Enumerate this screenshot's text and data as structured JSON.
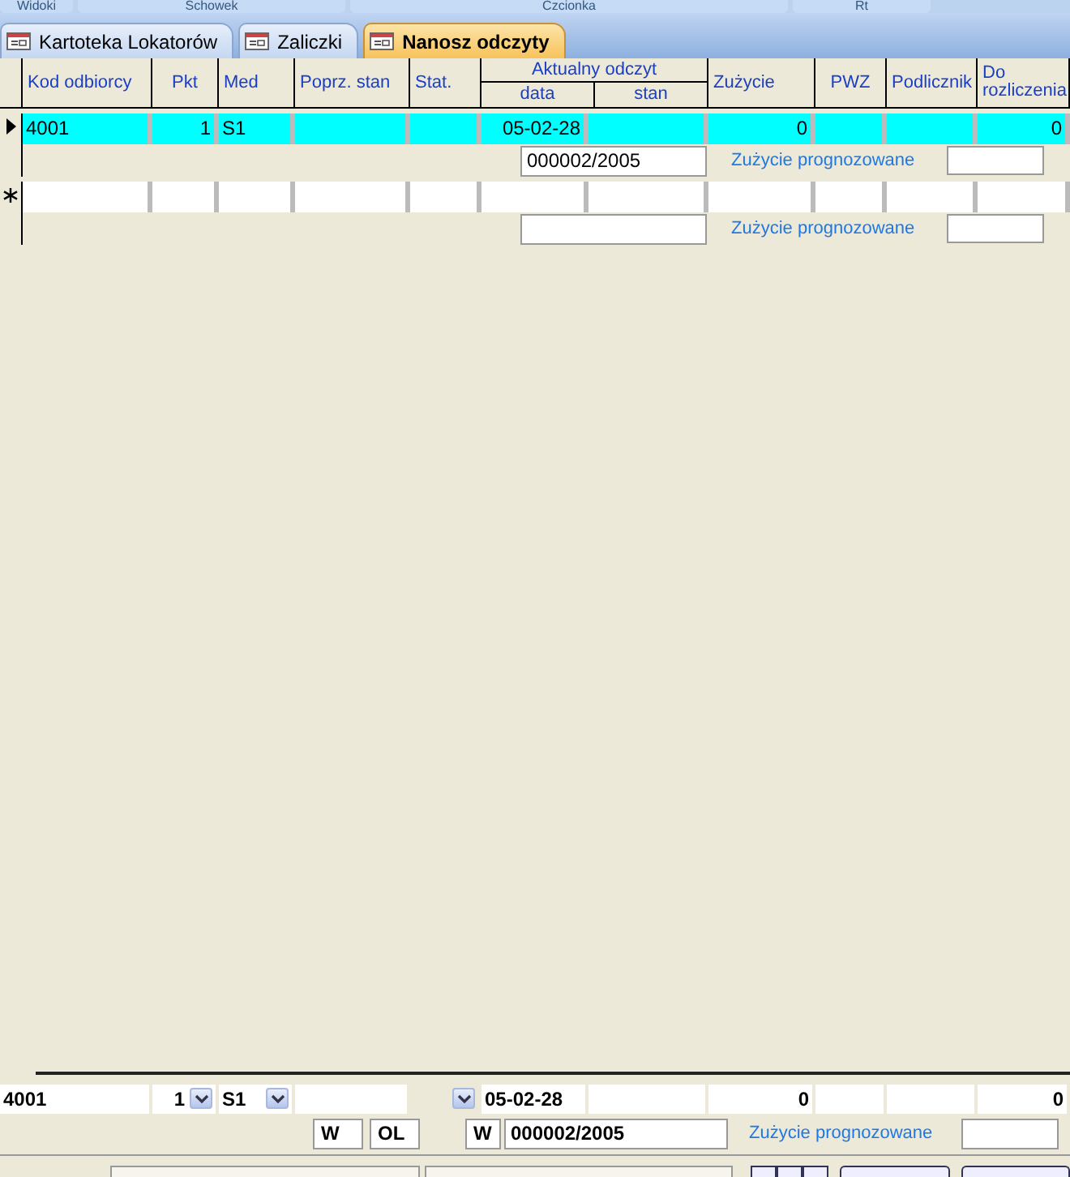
{
  "ribbon": {
    "groups": [
      "Widoki",
      "Schowek",
      "Czcionka",
      "Rt"
    ]
  },
  "tabs": [
    {
      "label": "Kartoteka Lokatorów",
      "selected": false
    },
    {
      "label": "Zaliczki",
      "selected": false
    },
    {
      "label": "Nanosz odczyty",
      "selected": true
    }
  ],
  "table": {
    "columns": [
      {
        "label": "Kod odbiorcy"
      },
      {
        "label": "Pkt"
      },
      {
        "label": "Med"
      },
      {
        "label": "Poprz. stan"
      },
      {
        "label": "Stat."
      },
      {
        "label": "Aktualny odczyt",
        "children": [
          {
            "label": "data"
          },
          {
            "label": "stan"
          }
        ]
      },
      {
        "label": "Zużycie"
      },
      {
        "label": "PWZ"
      },
      {
        "label": "Podlicznik"
      },
      {
        "label": "Do rozliczenia"
      }
    ],
    "rows": [
      {
        "kind": "current",
        "selected": true,
        "cells": [
          "4001",
          "1",
          "S1",
          null,
          null,
          "05-02-28",
          null,
          "0",
          null,
          null,
          "0"
        ],
        "number": "000002/2005",
        "forecast_label": "Zużycie prognozowane"
      },
      {
        "kind": "new",
        "selected": false,
        "cells": [
          null,
          null,
          null,
          null,
          null,
          null,
          null,
          null,
          null,
          null,
          null
        ],
        "forecast_label": "Zużycie prognozowane"
      }
    ]
  },
  "footer": {
    "fields": [
      {
        "kind": "text",
        "value": "4001"
      },
      {
        "kind": "combo",
        "value": "1"
      },
      {
        "kind": "combo",
        "value": "S1"
      },
      {
        "kind": "text"
      },
      {
        "kind": "combo"
      },
      {
        "kind": "text",
        "value": "05-02-28"
      },
      {
        "kind": "text"
      },
      {
        "kind": "text",
        "value": "0"
      },
      {
        "kind": "text"
      },
      {
        "kind": "text"
      },
      {
        "kind": "text",
        "value": "0"
      }
    ],
    "flags": [
      "W",
      "OL"
    ],
    "number_flag": "W",
    "number": "000002/2005",
    "forecast_label": "Zużycie prognozowane"
  }
}
